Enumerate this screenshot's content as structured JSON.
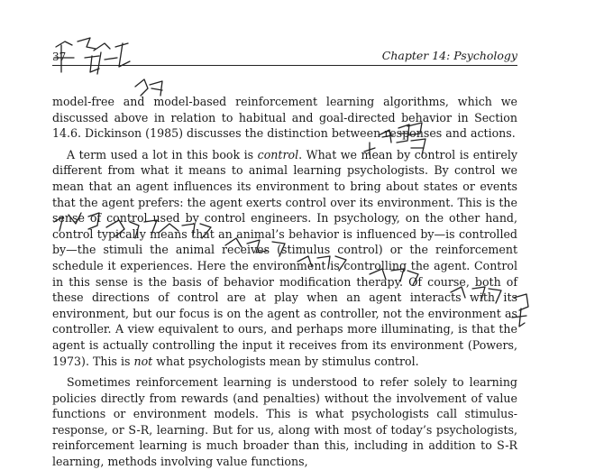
{
  "header": {
    "page_number": "37",
    "running_head": "Chapter 14: Psychology"
  },
  "paragraphs": [
    {
      "segments": [
        "model-free and model-based reinforcement learning algorithms, which we discussed above in relation to habitual and goal-directed behavior in Section 14.6. Dickinson (1985) discusses the distinction between responses and actions."
      ]
    },
    {
      "segments": [
        "A term used a lot in this book is ",
        "control",
        ". What we mean by control is entirely different from what it means to animal learning psychologists. By control we mean that an agent influences its environment to bring about states or events that the agent prefers: the agent exerts control over its environment. This is the sense of control used by control engineers. In psychology, on the other hand, control typically means that an animal’s behavior is influenced by—is controlled by—the stimuli the animal receives (stimulus control) or the reinforcement schedule it experiences. Here the environment is controlling the agent. Control in this sense is the basis of behavior modification therapy. Of course, both of these directions of control are at play when an agent interacts with its environment, but our focus is on the agent as controller, not the environment as controller. A view equivalent to ours, and perhaps more illuminating, is that the agent is actually controlling the input it receives from its environment (Powers, 1973). This is ",
        "not",
        " what psychologists mean by stimulus control."
      ]
    },
    {
      "segments": [
        "Sometimes reinforcement learning is understood to refer solely to learning policies directly from rewards (and penalties) without the involvement of value functions or environment models. This is what psychologists call stimulus-response, or S-R, learning. But for us, along with most of today’s psychologists, reinforcement learning is much broader than this, including in addition to S-R learning, methods involving value functions,"
      ]
    }
  ],
  "handwritten_notes": [
    "琵琶行",
    "舫",
    "自居易",
    "以低吟长吁的心绪下比乐笔乐曲，演奏深高山流水的时间与精神，手"
  ]
}
